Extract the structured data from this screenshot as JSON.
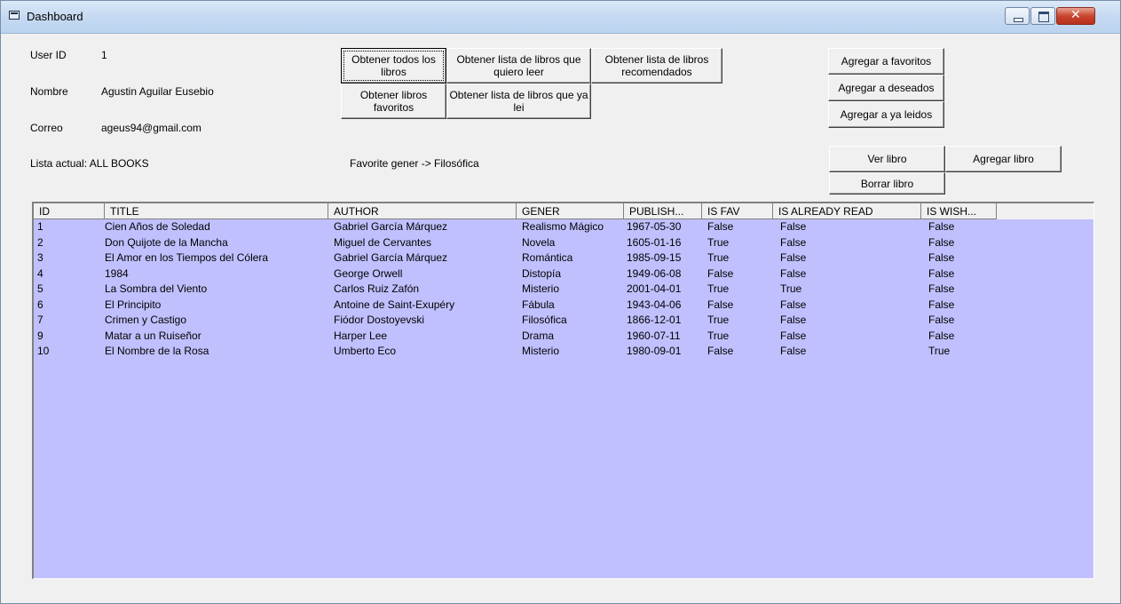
{
  "window": {
    "title": "Dashboard"
  },
  "user": {
    "id_label": "User ID",
    "id_value": "1",
    "name_label": "Nombre",
    "name_value": "Agustin Aguilar Eusebio",
    "email_label": "Correo",
    "email_value": "ageus94@gmail.com"
  },
  "status": {
    "current_list": "Lista actual: ALL BOOKS",
    "favorite_gener": "Favorite gener -> Filosófica"
  },
  "buttons": {
    "all_books": "Obtener todos los libros",
    "want_to_read": "Obtener lista de libros que quiero leer",
    "recommended": "Obtener lista de libros recomendados",
    "favorites": "Obtener libros favoritos",
    "already_read": "Obtener lista de libros que ya lei",
    "add_favorites": "Agregar a favoritos",
    "add_wishlist": "Agregar a deseados",
    "add_read": "Agregar a ya leidos",
    "view_book": "Ver libro",
    "add_book": "Agregar libro",
    "delete_book": "Borrar libro"
  },
  "table": {
    "columns": [
      "ID",
      "TITLE",
      "AUTHOR",
      "GENER",
      "PUBLISH...",
      "IS FAV",
      "IS ALREADY READ",
      "IS WISH..."
    ],
    "rows": [
      [
        "1",
        "Cien Años de Soledad",
        "Gabriel García Márquez",
        "Realismo Mágico",
        "1967-05-30",
        "False",
        "False",
        "False"
      ],
      [
        "2",
        "Don Quijote de la Mancha",
        "Miguel de Cervantes",
        "Novela",
        "1605-01-16",
        "True",
        "False",
        "False"
      ],
      [
        "3",
        "El Amor en los Tiempos del Cólera",
        "Gabriel García Márquez",
        "Romántica",
        "1985-09-15",
        "True",
        "False",
        "False"
      ],
      [
        "4",
        "1984",
        "George Orwell",
        "Distopía",
        "1949-06-08",
        "False",
        "False",
        "False"
      ],
      [
        "5",
        "La Sombra del Viento",
        "Carlos Ruiz Zafón",
        "Misterio",
        "2001-04-01",
        "True",
        "True",
        "False"
      ],
      [
        "6",
        "El Principito",
        "Antoine de Saint-Exupéry",
        "Fábula",
        "1943-04-06",
        "False",
        "False",
        "False"
      ],
      [
        "7",
        "Crimen y Castigo",
        "Fiódor Dostoyevski",
        "Filosófica",
        "1866-12-01",
        "True",
        "False",
        "False"
      ],
      [
        "9",
        "Matar a un Ruiseñor",
        "Harper Lee",
        "Drama",
        "1960-07-11",
        "True",
        "False",
        "False"
      ],
      [
        "10",
        "El Nombre de la Rosa",
        "Umberto Eco",
        "Misterio",
        "1980-09-01",
        "False",
        "False",
        "True"
      ]
    ]
  },
  "colors": {
    "list_background": "#c0c0ff",
    "window_background": "#f0f0f0"
  }
}
